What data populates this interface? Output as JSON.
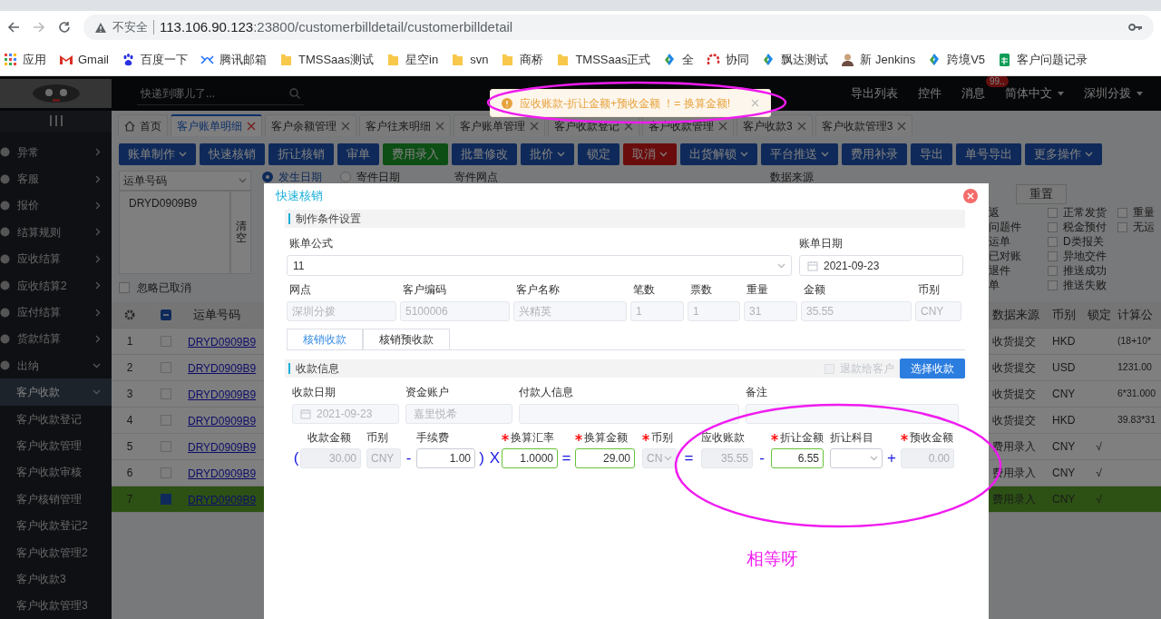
{
  "browser": {
    "address": {
      "security": "不安全",
      "host": "113.106.90.123",
      "path": ":23800/customerbilldetail/customerbilldetail"
    },
    "bookmarks": [
      {
        "label": "应用",
        "kind": "apps"
      },
      {
        "label": "Gmail",
        "kind": "gmail"
      },
      {
        "label": "百度一下",
        "kind": "paw"
      },
      {
        "label": "腾讯邮箱",
        "kind": "mail"
      },
      {
        "label": "TMSSaas测试",
        "kind": "folder"
      },
      {
        "label": "星空in",
        "kind": "folder"
      },
      {
        "label": "svn",
        "kind": "folder"
      },
      {
        "label": "商桥",
        "kind": "folder"
      },
      {
        "label": "TMSSaas正式",
        "kind": "folder"
      },
      {
        "label": "全",
        "kind": "diamond"
      },
      {
        "label": "协同",
        "kind": "arch"
      },
      {
        "label": "飘达测试",
        "kind": "diamond"
      },
      {
        "label": "新 Jenkins",
        "kind": "person"
      },
      {
        "label": "跨境V5",
        "kind": "diamond"
      },
      {
        "label": "客户问题记录",
        "kind": "sheet"
      }
    ]
  },
  "header": {
    "search": {
      "placeholder": "快递到哪儿了..."
    },
    "menu": [
      {
        "label": "导出列表",
        "dropdown": false
      },
      {
        "label": "控件",
        "dropdown": false
      },
      {
        "label": "消息",
        "dropdown": false,
        "badge": "99.."
      },
      {
        "label": "简体中文",
        "dropdown": true
      },
      {
        "label": "深圳分拨",
        "dropdown": true
      }
    ]
  },
  "toast": {
    "message": "应收账款-折让金额+预收金额 ！= 换算金额!"
  },
  "sidebar": {
    "items": [
      {
        "label": "异常",
        "expanded": false
      },
      {
        "label": "客服",
        "expanded": false
      },
      {
        "label": "报价",
        "expanded": false
      },
      {
        "label": "结算规则",
        "expanded": false
      },
      {
        "label": "应收结算",
        "expanded": false
      },
      {
        "label": "应收结算2",
        "expanded": false
      },
      {
        "label": "应付结算",
        "expanded": false
      },
      {
        "label": "货款结算",
        "expanded": false
      },
      {
        "label": "出纳",
        "expanded": true,
        "children": [
          {
            "label": "客户收款",
            "expanded": true,
            "selected": true,
            "children": [
              {
                "label": "客户收款登记",
                "selected": false
              },
              {
                "label": "客户收款管理",
                "selected": false
              },
              {
                "label": "客户收款审核",
                "selected": false
              },
              {
                "label": "客户核销管理",
                "selected": false
              },
              {
                "label": "客户收款登记2",
                "selected": false
              },
              {
                "label": "客户收款管理2",
                "selected": false
              },
              {
                "label": "客户收款3",
                "selected": false
              },
              {
                "label": "客户收款管理3",
                "selected": false
              }
            ]
          }
        ]
      }
    ]
  },
  "tabs": [
    {
      "label": "首页",
      "kind": "home",
      "selected": false
    },
    {
      "label": "客户账单明细",
      "kind": "page",
      "selected": true
    },
    {
      "label": "客户余额管理",
      "kind": "page",
      "selected": false
    },
    {
      "label": "客户往来明细",
      "kind": "page",
      "selected": false
    },
    {
      "label": "客户账单管理",
      "kind": "page",
      "selected": false
    },
    {
      "label": "客户收款登记",
      "kind": "page",
      "selected": false
    },
    {
      "label": "客户收款管理",
      "kind": "page",
      "selected": false
    },
    {
      "label": "客户收款3",
      "kind": "page",
      "selected": false
    },
    {
      "label": "客户收款管理3",
      "kind": "page",
      "selected": false
    }
  ],
  "toolbar": [
    {
      "label": "账单制作",
      "kind": "primary",
      "dropdown": true
    },
    {
      "label": "快速核销",
      "kind": "primary",
      "dropdown": false
    },
    {
      "label": "折让核销",
      "kind": "primary",
      "dropdown": false
    },
    {
      "label": "审单",
      "kind": "primary",
      "dropdown": false
    },
    {
      "label": "费用录入",
      "kind": "success",
      "dropdown": false
    },
    {
      "label": "批量修改",
      "kind": "primary",
      "dropdown": false
    },
    {
      "label": "批价",
      "kind": "primary",
      "dropdown": true
    },
    {
      "label": "锁定",
      "kind": "primary",
      "dropdown": false
    },
    {
      "label": "取消",
      "kind": "danger",
      "dropdown": true
    },
    {
      "label": "出货解锁",
      "kind": "primary",
      "dropdown": true
    },
    {
      "label": "平台推送",
      "kind": "primary",
      "dropdown": true
    },
    {
      "label": "费用补录",
      "kind": "primary",
      "dropdown": false
    },
    {
      "label": "导出",
      "kind": "primary",
      "dropdown": false
    },
    {
      "label": "单号导出",
      "kind": "primary",
      "dropdown": false
    },
    {
      "label": "更多操作",
      "kind": "primary",
      "dropdown": true
    }
  ],
  "filters": {
    "field_select": "运单号码",
    "numbers": "DRYD0909B9",
    "clear": "清空",
    "ignore_cancelled": {
      "label": "忽略已取消",
      "checked": false
    },
    "date_options": [
      {
        "label": "发生日期",
        "selected": true
      },
      {
        "label": "寄件日期",
        "selected": false
      }
    ],
    "labels": [
      "寄件网点",
      "数据来源"
    ],
    "reset": "重置",
    "flags": [
      {
        "label": "返",
        "kind": "text"
      },
      {
        "label": "正常发货",
        "kind": "checkbox",
        "checked": false
      },
      {
        "label": "重量",
        "kind": "checkbox",
        "checked": false
      },
      {
        "label": "问题件",
        "kind": "text"
      },
      {
        "label": "税金预付",
        "kind": "checkbox",
        "checked": false
      },
      {
        "label": "无运",
        "kind": "checkbox",
        "checked": false
      },
      {
        "label": "运单",
        "kind": "text"
      },
      {
        "label": "D类报关",
        "kind": "checkbox",
        "checked": false
      },
      {
        "kind": "none"
      },
      {
        "label": "已对账",
        "kind": "text"
      },
      {
        "label": "异地交件",
        "kind": "checkbox",
        "checked": false
      },
      {
        "kind": "none"
      },
      {
        "label": "退件",
        "kind": "text"
      },
      {
        "label": "推送成功",
        "kind": "checkbox",
        "checked": false
      },
      {
        "kind": "none"
      },
      {
        "label": "单",
        "kind": "text"
      },
      {
        "label": "推送失败",
        "kind": "checkbox",
        "checked": false
      },
      {
        "kind": "none"
      }
    ]
  },
  "table": {
    "select_all": {
      "indeterminate": true
    },
    "columns": [
      "运单号码",
      "数据来源",
      "币别",
      "锁定",
      "计算公"
    ],
    "rows": [
      {
        "index": "1",
        "waybill": "DRYD0909B9",
        "source": "收货提交",
        "currency": "HKD",
        "formula": "(18+10*",
        "selected": false
      },
      {
        "index": "2",
        "waybill": "DRYD0909B9",
        "source": "收货提交",
        "currency": "USD",
        "formula": "1231.00",
        "selected": false
      },
      {
        "index": "3",
        "waybill": "DRYD0909B9",
        "source": "收货提交",
        "currency": "CNY",
        "formula": "6*31.000",
        "selected": false
      },
      {
        "index": "4",
        "waybill": "DRYD0909B9",
        "source": "收货提交",
        "currency": "HKD",
        "formula": "39.83*31",
        "selected": false
      },
      {
        "index": "5",
        "waybill": "DRYD0909B9",
        "source": "费用录入",
        "currency": "CNY",
        "locked": "√",
        "selected": false
      },
      {
        "index": "6",
        "waybill": "DRYD0909B9",
        "source": "费用录入",
        "currency": "CNY",
        "locked": "√",
        "selected": false
      },
      {
        "index": "7",
        "waybill": "DRYD0909B9",
        "source": "费用录入",
        "currency": "CNY",
        "locked": "√",
        "selected": true
      }
    ]
  },
  "modal": {
    "title": "快速核销",
    "section1": "制作条件设置",
    "formula_label": "账单公式",
    "formula_value": "11",
    "bill_date_label": "账单日期",
    "bill_date": "2021-09-23",
    "info": [
      {
        "label": "网点",
        "value": "深圳分拨"
      },
      {
        "label": "客户编码",
        "value": "5100006"
      },
      {
        "label": "客户名称",
        "value": "兴精英"
      },
      {
        "label": "笔数",
        "value": "1"
      },
      {
        "label": "票数",
        "value": "1"
      },
      {
        "label": "重量",
        "value": "31"
      },
      {
        "label": "金额",
        "value": "35.55"
      },
      {
        "label": "币别",
        "value": "CNY"
      }
    ],
    "tabs": [
      {
        "label": "核销收款",
        "selected": true
      },
      {
        "label": "核销预收款",
        "selected": false
      }
    ],
    "section2": "收款信息",
    "refund": {
      "label": "退款给客户",
      "checked": false,
      "disabled": true
    },
    "select_button": "选择收款",
    "receipt": [
      {
        "label": "收款日期",
        "value": "2021-09-23",
        "kind": "date"
      },
      {
        "label": "资金账户",
        "value": "嘉里悦希",
        "kind": "input"
      },
      {
        "label": "付款人信息",
        "kind": "input"
      },
      {
        "label": "备注",
        "kind": "input"
      }
    ],
    "calc": [
      {
        "kind": "op",
        "text": "("
      },
      {
        "kind": "input",
        "label": "收款金额",
        "value": "30.00",
        "required": false,
        "disabled": true,
        "valid": false
      },
      {
        "kind": "input",
        "label": "币别",
        "value": "CNY",
        "required": false,
        "disabled": true,
        "valid": false,
        "numeric": false
      },
      {
        "kind": "op",
        "text": "-"
      },
      {
        "kind": "input",
        "label": "手续费",
        "value": "1.00",
        "required": false,
        "disabled": false,
        "valid": false
      },
      {
        "kind": "op",
        "text": ")"
      },
      {
        "kind": "op",
        "text": "X"
      },
      {
        "kind": "input",
        "label": "换算汇率",
        "value": "1.0000",
        "required": true,
        "disabled": false,
        "valid": true
      },
      {
        "kind": "op",
        "text": "="
      },
      {
        "kind": "input",
        "label": "换算金额",
        "value": "29.00",
        "required": true,
        "disabled": false,
        "valid": true
      },
      {
        "kind": "select",
        "label": "币别",
        "value": "CN",
        "required": true,
        "disabled": true,
        "valid": false
      },
      {
        "kind": "op",
        "text": "="
      },
      {
        "kind": "input",
        "label": "应收账款",
        "value": "35.55",
        "required": false,
        "disabled": true,
        "valid": false
      },
      {
        "kind": "op",
        "text": "-"
      },
      {
        "kind": "input",
        "label": "折让金额",
        "value": "6.55",
        "required": true,
        "disabled": false,
        "valid": true
      },
      {
        "kind": "select",
        "label": "折让科目",
        "required": false,
        "disabled": false,
        "valid": false
      },
      {
        "kind": "op",
        "text": "+"
      },
      {
        "kind": "input",
        "label": "预收金额",
        "value": "0.00",
        "required": true,
        "disabled": true,
        "valid": false
      }
    ]
  },
  "annotation": {
    "note": "相等呀"
  }
}
